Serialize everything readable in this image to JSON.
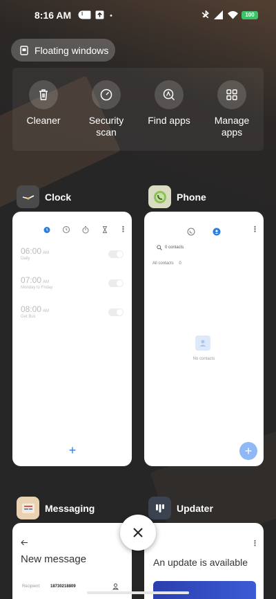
{
  "status_bar": {
    "time": "8:16 AM",
    "battery": "100"
  },
  "floating_windows": {
    "label": "Floating windows"
  },
  "quick_actions": [
    {
      "id": "cleaner",
      "label": "Cleaner",
      "icon": "trash-icon"
    },
    {
      "id": "security",
      "label": "Security\nscan",
      "icon": "gauge-icon"
    },
    {
      "id": "find",
      "label": "Find apps",
      "icon": "search-app-icon"
    },
    {
      "id": "manage",
      "label": "Manage\napps",
      "icon": "grid-icon"
    }
  ],
  "apps": {
    "clock": {
      "name": "Clock",
      "alarms": [
        {
          "time": "06:00",
          "ampm": "AM",
          "sub": "Daily"
        },
        {
          "time": "07:00",
          "ampm": "AM",
          "sub": "Monday to Friday"
        },
        {
          "time": "08:00",
          "ampm": "AM",
          "sub": "Get Bus"
        }
      ]
    },
    "phone": {
      "name": "Phone",
      "search_text": "0 contacts",
      "filter_text": "All contacts",
      "filter_count": "0",
      "empty_text": "No contacts"
    },
    "messaging": {
      "name": "Messaging",
      "title": "New message",
      "recipient_label": "Recipient:",
      "recipient_value": "18730218809"
    },
    "updater": {
      "name": "Updater",
      "title": "An update is available"
    }
  },
  "colors": {
    "accent": "#2b7de1",
    "battery": "#3cc36a",
    "fab_phone": "#8fb8f5"
  }
}
